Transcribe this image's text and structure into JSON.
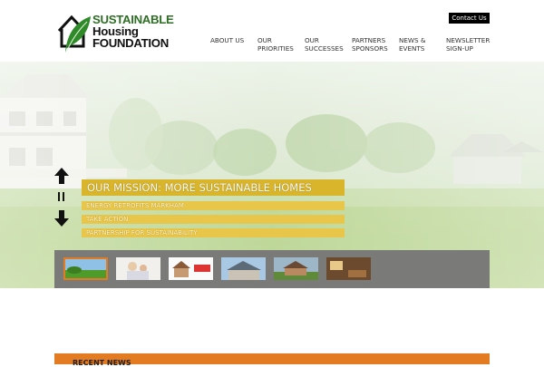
{
  "header": {
    "logo": {
      "line1": "SUSTAINABLE",
      "line2": "Housing",
      "line3": "FOUNDATION"
    },
    "contact_label": "Contact Us"
  },
  "nav": [
    {
      "line1": "ABOUT US",
      "line2": ""
    },
    {
      "line1": "OUR",
      "line2": "PRIORITIES"
    },
    {
      "line1": "OUR",
      "line2": "SUCCESSES"
    },
    {
      "line1": "PARTNERS",
      "line2": "SPONSORS"
    },
    {
      "line1": "NEWS &",
      "line2": "EVENTS"
    },
    {
      "line1": "NEWSLETTER",
      "line2": "SIGN-UP"
    }
  ],
  "hero": {
    "mission": "OUR MISSION: MORE SUSTAINABLE HOMES",
    "links": [
      "ENERGY RETROFITS MARKHAM",
      "TAKE ACTION",
      "PARTNERSHIP FOR SUSTAINABILITY"
    ]
  },
  "news": {
    "label": "RECENT NEWS"
  },
  "colors": {
    "brand_green": "#2f6e25",
    "gold": "#d9b52c",
    "orange": "#e37b22",
    "thumb_bar": "#7a7a78"
  }
}
